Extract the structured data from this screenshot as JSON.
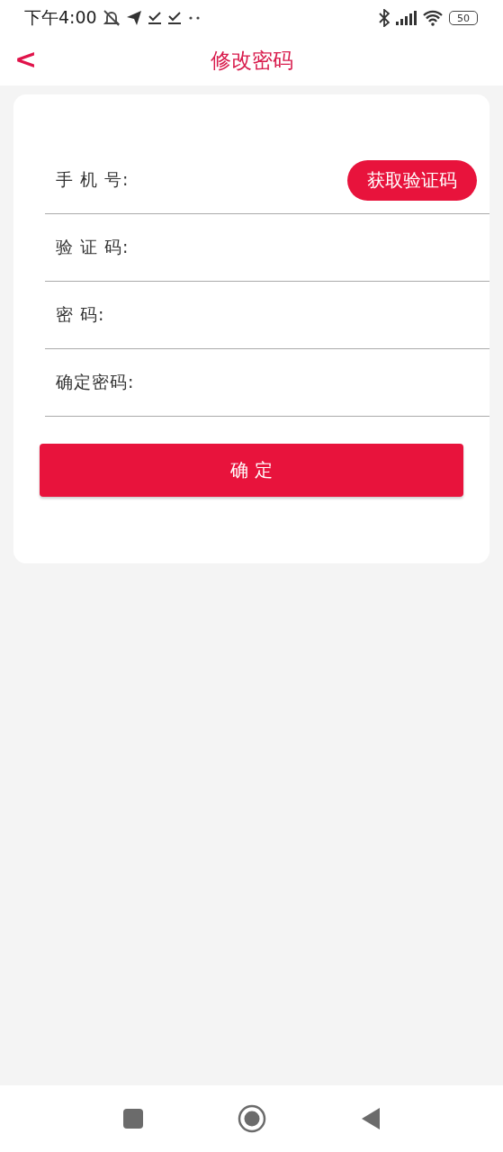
{
  "status_bar": {
    "time": "下午4:00",
    "battery": "50"
  },
  "header": {
    "back": "<",
    "title": "修改密码"
  },
  "fields": [
    {
      "label": "手 机 号:",
      "action": "获取验证码"
    },
    {
      "label": "验 证 码:"
    },
    {
      "label": "密 码:"
    },
    {
      "label": "确定密码:"
    }
  ],
  "submit": "确 定"
}
